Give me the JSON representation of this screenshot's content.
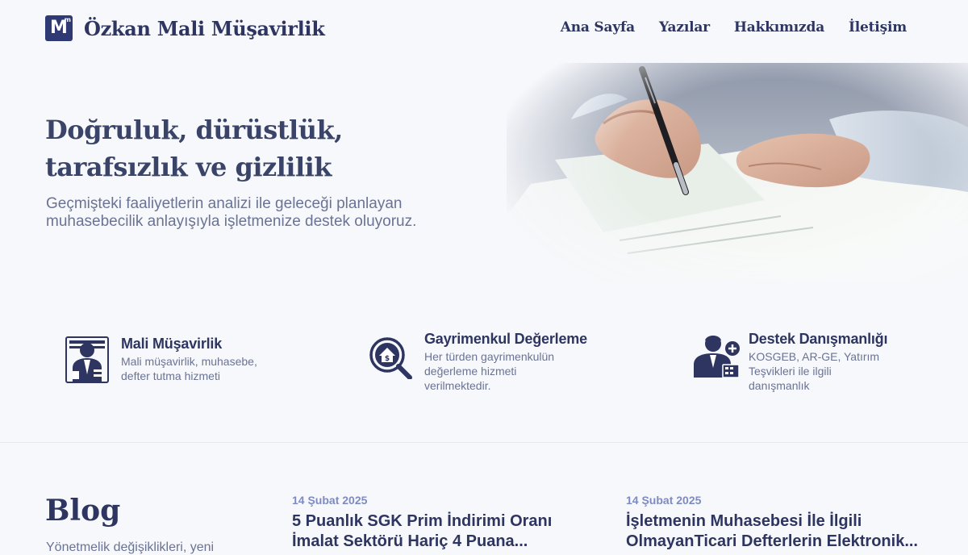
{
  "brand": {
    "logo_letter": "M",
    "logo_sup": "m",
    "name": "Özkan Mali Müşavirlik"
  },
  "nav": {
    "items": [
      "Ana Sayfa",
      "Yazılar",
      "Hakkımızda",
      "İletişim"
    ]
  },
  "hero": {
    "title_line1": "Doğruluk, dürüstlük,",
    "title_line2": "tarafsızlık ve gizlilik",
    "subtitle_line1": "Geçmişteki faaliyetlerin analizi ile geleceği planlayan",
    "subtitle_line2": "muhasebecilik anlayışıyla işletmenize destek oluyoruz."
  },
  "services": [
    {
      "icon": "accountant-icon",
      "title": "Mali Müşavirlik",
      "desc": [
        "Mali müşavirlik, muhasebe,",
        "defter tutma hizmeti"
      ]
    },
    {
      "icon": "house-valuation-icon",
      "title": "Gayrimenkul Değerleme",
      "desc": [
        "Her türden gayrimenkulün",
        "değerleme hizmeti",
        "verilmektedir."
      ]
    },
    {
      "icon": "consultant-icon",
      "title": "Destek Danışmanlığı",
      "desc": [
        "KOSGEB, AR-GE, Yatırım",
        "Teşvikleri ile ilgili",
        "danışmanlık"
      ]
    }
  ],
  "blog": {
    "title": "Blog",
    "subtitle": "Yönetmelik değişiklikleri, yeni",
    "posts": [
      {
        "date": "14 Şubat 2025",
        "title_line1": "5 Puanlık SGK Prim İndirimi Oranı",
        "title_line2": "İmalat Sektörü Hariç 4 Puana..."
      },
      {
        "date": "14 Şubat 2025",
        "title_line1": "İşletmenin Muhasebesi İle İlgili",
        "title_line2": "OlmayanTicari Defterlerin Elektronik..."
      }
    ]
  },
  "colors": {
    "navy": "#2d3560",
    "muted": "#6a7394",
    "accent_date": "#7d8bc4",
    "background": "#f7f8fb"
  }
}
